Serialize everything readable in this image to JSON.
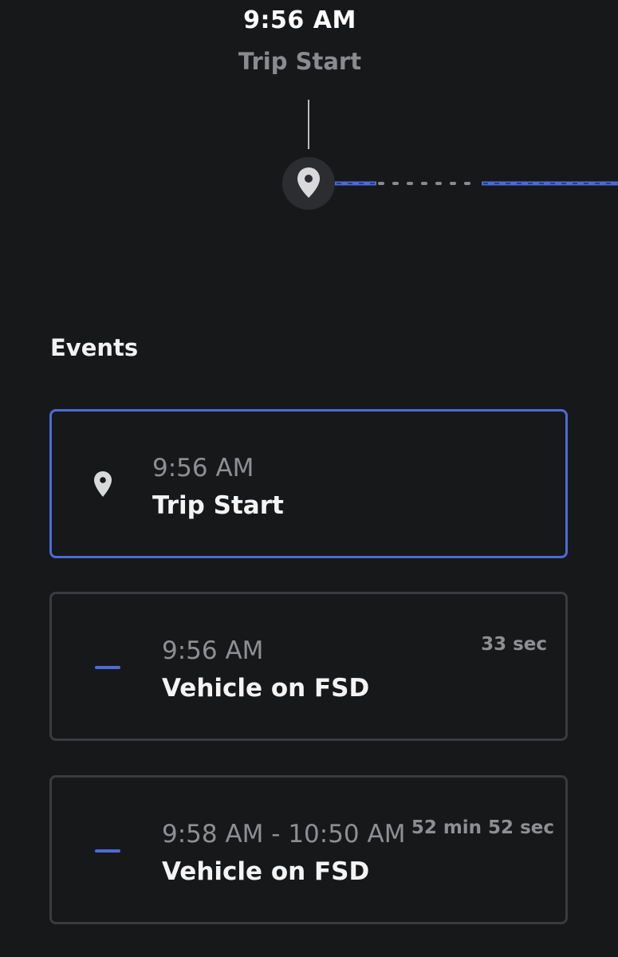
{
  "timeline": {
    "time": "9:56 AM",
    "label": "Trip Start",
    "active_color": "#4c6bd6",
    "inactive_color": "#8a8b8e"
  },
  "events_heading": "Events",
  "events": [
    {
      "icon": "location-pin-icon",
      "time": "9:56 AM",
      "title": "Trip Start",
      "duration": "",
      "selected": true
    },
    {
      "icon": "fsd-dash-icon",
      "time": "9:56 AM",
      "title": "Vehicle on FSD",
      "duration": "33 sec",
      "selected": false
    },
    {
      "icon": "fsd-dash-icon",
      "time": "9:58 AM - 10:50 AM",
      "title": "Vehicle on FSD",
      "duration": "52 min 52 sec",
      "selected": false
    }
  ],
  "colors": {
    "background": "#17181a",
    "card_border": "#3a3b3e",
    "selected_border": "#4c6bd6",
    "fsd_accent": "#4c6bd6"
  }
}
